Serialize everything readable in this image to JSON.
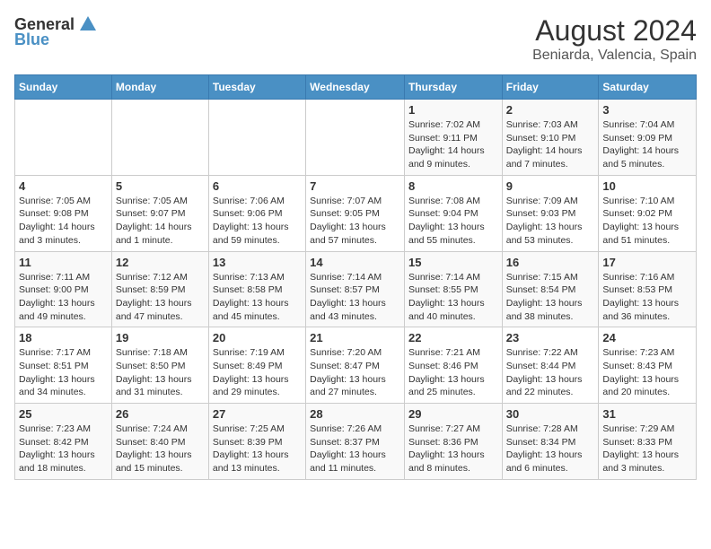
{
  "logo": {
    "general": "General",
    "blue": "Blue"
  },
  "title": "August 2024",
  "subtitle": "Beniarda, Valencia, Spain",
  "weekdays": [
    "Sunday",
    "Monday",
    "Tuesday",
    "Wednesday",
    "Thursday",
    "Friday",
    "Saturday"
  ],
  "weeks": [
    [
      {
        "day": "",
        "sunrise": "",
        "sunset": "",
        "daylight": ""
      },
      {
        "day": "",
        "sunrise": "",
        "sunset": "",
        "daylight": ""
      },
      {
        "day": "",
        "sunrise": "",
        "sunset": "",
        "daylight": ""
      },
      {
        "day": "",
        "sunrise": "",
        "sunset": "",
        "daylight": ""
      },
      {
        "day": "1",
        "sunrise": "Sunrise: 7:02 AM",
        "sunset": "Sunset: 9:11 PM",
        "daylight": "Daylight: 14 hours and 9 minutes."
      },
      {
        "day": "2",
        "sunrise": "Sunrise: 7:03 AM",
        "sunset": "Sunset: 9:10 PM",
        "daylight": "Daylight: 14 hours and 7 minutes."
      },
      {
        "day": "3",
        "sunrise": "Sunrise: 7:04 AM",
        "sunset": "Sunset: 9:09 PM",
        "daylight": "Daylight: 14 hours and 5 minutes."
      }
    ],
    [
      {
        "day": "4",
        "sunrise": "Sunrise: 7:05 AM",
        "sunset": "Sunset: 9:08 PM",
        "daylight": "Daylight: 14 hours and 3 minutes."
      },
      {
        "day": "5",
        "sunrise": "Sunrise: 7:05 AM",
        "sunset": "Sunset: 9:07 PM",
        "daylight": "Daylight: 14 hours and 1 minute."
      },
      {
        "day": "6",
        "sunrise": "Sunrise: 7:06 AM",
        "sunset": "Sunset: 9:06 PM",
        "daylight": "Daylight: 13 hours and 59 minutes."
      },
      {
        "day": "7",
        "sunrise": "Sunrise: 7:07 AM",
        "sunset": "Sunset: 9:05 PM",
        "daylight": "Daylight: 13 hours and 57 minutes."
      },
      {
        "day": "8",
        "sunrise": "Sunrise: 7:08 AM",
        "sunset": "Sunset: 9:04 PM",
        "daylight": "Daylight: 13 hours and 55 minutes."
      },
      {
        "day": "9",
        "sunrise": "Sunrise: 7:09 AM",
        "sunset": "Sunset: 9:03 PM",
        "daylight": "Daylight: 13 hours and 53 minutes."
      },
      {
        "day": "10",
        "sunrise": "Sunrise: 7:10 AM",
        "sunset": "Sunset: 9:02 PM",
        "daylight": "Daylight: 13 hours and 51 minutes."
      }
    ],
    [
      {
        "day": "11",
        "sunrise": "Sunrise: 7:11 AM",
        "sunset": "Sunset: 9:00 PM",
        "daylight": "Daylight: 13 hours and 49 minutes."
      },
      {
        "day": "12",
        "sunrise": "Sunrise: 7:12 AM",
        "sunset": "Sunset: 8:59 PM",
        "daylight": "Daylight: 13 hours and 47 minutes."
      },
      {
        "day": "13",
        "sunrise": "Sunrise: 7:13 AM",
        "sunset": "Sunset: 8:58 PM",
        "daylight": "Daylight: 13 hours and 45 minutes."
      },
      {
        "day": "14",
        "sunrise": "Sunrise: 7:14 AM",
        "sunset": "Sunset: 8:57 PM",
        "daylight": "Daylight: 13 hours and 43 minutes."
      },
      {
        "day": "15",
        "sunrise": "Sunrise: 7:14 AM",
        "sunset": "Sunset: 8:55 PM",
        "daylight": "Daylight: 13 hours and 40 minutes."
      },
      {
        "day": "16",
        "sunrise": "Sunrise: 7:15 AM",
        "sunset": "Sunset: 8:54 PM",
        "daylight": "Daylight: 13 hours and 38 minutes."
      },
      {
        "day": "17",
        "sunrise": "Sunrise: 7:16 AM",
        "sunset": "Sunset: 8:53 PM",
        "daylight": "Daylight: 13 hours and 36 minutes."
      }
    ],
    [
      {
        "day": "18",
        "sunrise": "Sunrise: 7:17 AM",
        "sunset": "Sunset: 8:51 PM",
        "daylight": "Daylight: 13 hours and 34 minutes."
      },
      {
        "day": "19",
        "sunrise": "Sunrise: 7:18 AM",
        "sunset": "Sunset: 8:50 PM",
        "daylight": "Daylight: 13 hours and 31 minutes."
      },
      {
        "day": "20",
        "sunrise": "Sunrise: 7:19 AM",
        "sunset": "Sunset: 8:49 PM",
        "daylight": "Daylight: 13 hours and 29 minutes."
      },
      {
        "day": "21",
        "sunrise": "Sunrise: 7:20 AM",
        "sunset": "Sunset: 8:47 PM",
        "daylight": "Daylight: 13 hours and 27 minutes."
      },
      {
        "day": "22",
        "sunrise": "Sunrise: 7:21 AM",
        "sunset": "Sunset: 8:46 PM",
        "daylight": "Daylight: 13 hours and 25 minutes."
      },
      {
        "day": "23",
        "sunrise": "Sunrise: 7:22 AM",
        "sunset": "Sunset: 8:44 PM",
        "daylight": "Daylight: 13 hours and 22 minutes."
      },
      {
        "day": "24",
        "sunrise": "Sunrise: 7:23 AM",
        "sunset": "Sunset: 8:43 PM",
        "daylight": "Daylight: 13 hours and 20 minutes."
      }
    ],
    [
      {
        "day": "25",
        "sunrise": "Sunrise: 7:23 AM",
        "sunset": "Sunset: 8:42 PM",
        "daylight": "Daylight: 13 hours and 18 minutes."
      },
      {
        "day": "26",
        "sunrise": "Sunrise: 7:24 AM",
        "sunset": "Sunset: 8:40 PM",
        "daylight": "Daylight: 13 hours and 15 minutes."
      },
      {
        "day": "27",
        "sunrise": "Sunrise: 7:25 AM",
        "sunset": "Sunset: 8:39 PM",
        "daylight": "Daylight: 13 hours and 13 minutes."
      },
      {
        "day": "28",
        "sunrise": "Sunrise: 7:26 AM",
        "sunset": "Sunset: 8:37 PM",
        "daylight": "Daylight: 13 hours and 11 minutes."
      },
      {
        "day": "29",
        "sunrise": "Sunrise: 7:27 AM",
        "sunset": "Sunset: 8:36 PM",
        "daylight": "Daylight: 13 hours and 8 minutes."
      },
      {
        "day": "30",
        "sunrise": "Sunrise: 7:28 AM",
        "sunset": "Sunset: 8:34 PM",
        "daylight": "Daylight: 13 hours and 6 minutes."
      },
      {
        "day": "31",
        "sunrise": "Sunrise: 7:29 AM",
        "sunset": "Sunset: 8:33 PM",
        "daylight": "Daylight: 13 hours and 3 minutes."
      }
    ]
  ]
}
